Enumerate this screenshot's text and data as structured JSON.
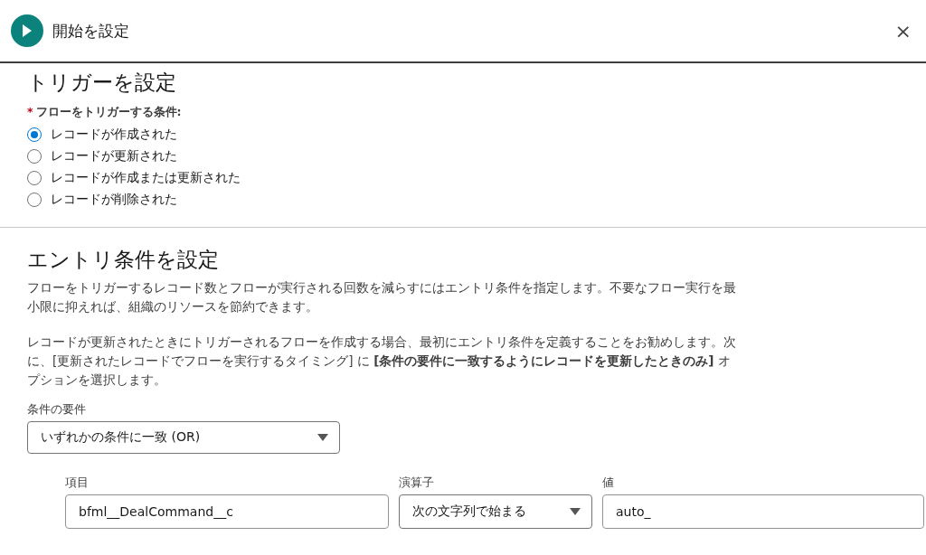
{
  "header": {
    "title": "開始を設定",
    "close": "×"
  },
  "trigger": {
    "heading": "トリガーを設定",
    "required_mark": "*",
    "label": "フローをトリガーする条件:",
    "options": [
      {
        "label": "レコードが作成された",
        "selected": true
      },
      {
        "label": "レコードが更新された",
        "selected": false
      },
      {
        "label": "レコードが作成または更新された",
        "selected": false
      },
      {
        "label": "レコードが削除された",
        "selected": false
      }
    ]
  },
  "entry": {
    "heading": "エントリ条件を設定",
    "paragraphs": [
      "フローをトリガーするレコード数とフローが実行される回数を減らすにはエントリ条件を指定します。不要なフロー実行を最小限に抑えれば、組織のリソースを節約できます。",
      "レコードが更新されたときにトリガーされるフローを作成する場合、最初にエントリ条件を定義することをお勧めします。次に、[更新されたレコードでフローを実行するタイミング] に **[条件の要件に一致するようにレコードを更新したときのみ]** オプションを選択します。"
    ],
    "requirement": {
      "label": "条件の要件",
      "value": "いずれかの条件に一致 (OR)"
    },
    "condition": {
      "field": {
        "label": "項目",
        "value": "bfml__DealCommand__c"
      },
      "operator": {
        "label": "演算子",
        "value": "次の文字列で始まる"
      },
      "value": {
        "label": "値",
        "value": "auto_"
      }
    }
  }
}
